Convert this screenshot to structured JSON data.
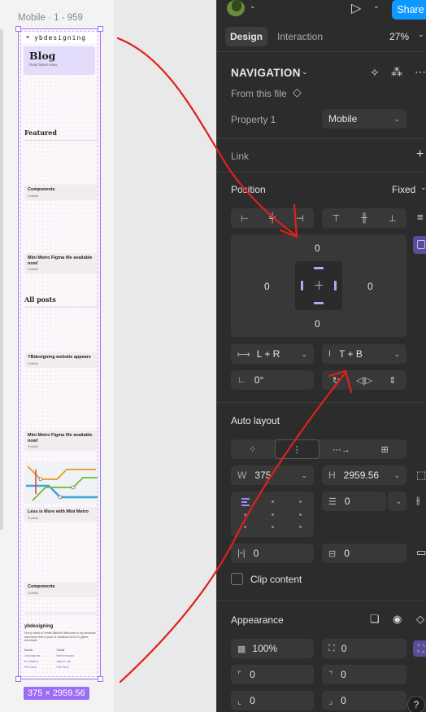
{
  "canvas": {
    "frame_label": "Mobile · 1 - 959",
    "size_badge": "375 × 2959.56",
    "mobile": {
      "logo": "ybdesigning",
      "hero_title": "Blog",
      "hero_subtitle": "Read latest news",
      "featured_title": "Featured",
      "all_posts_title": "All posts",
      "cards": [
        {
          "title": "Components",
          "subtitle": "Subtitle"
        },
        {
          "title": "Mini Metro Figma file available now!",
          "subtitle": "Subtitle"
        },
        {
          "title": "YBdesigning website appears",
          "subtitle": "Subtitle"
        },
        {
          "title": "Mini Metro Figma file available now!",
          "subtitle": "Subtitle"
        },
        {
          "title": "Less is More with Mini Metro",
          "subtitle": "Subtitle"
        },
        {
          "title": "Components",
          "subtitle": "Subtitle"
        }
      ],
      "footer": {
        "title": "ybdesigning",
        "desc": "Hi my name is Yende Bakker! Welcome to my personal adventure from a poor of classical UI/UX to game developer",
        "col1": [
          "Social",
          "Instagram",
          "Dribbble",
          "Patreon"
        ],
        "col2": [
          "Social",
          "References",
          "About me",
          "Patreon"
        ]
      }
    }
  },
  "panel": {
    "share_label": "Share",
    "tabs": [
      "Design",
      "Interaction"
    ],
    "zoom": "27%",
    "component": {
      "name": "NAVIGATION",
      "source": "From this file",
      "property_label": "Property 1",
      "property_value": "Mobile"
    },
    "link_label": "Link",
    "position": {
      "label": "Position",
      "mode": "Fixed",
      "top": "0",
      "left": "0",
      "right": "0",
      "bottom": "0",
      "horizontal_constraint": "L + R",
      "vertical_constraint": "T + B",
      "rotation": "0°"
    },
    "auto_layout": {
      "label": "Auto layout",
      "width_label": "W",
      "width": "375",
      "height_label": "H",
      "height": "2959.56",
      "gap": "0",
      "padding_h": "0",
      "padding_v": "0",
      "clip_label": "Clip content"
    },
    "appearance": {
      "label": "Appearance",
      "opacity": "100%",
      "corner": "0",
      "r_tl": "0",
      "r_tr": "0",
      "r_bl": "0",
      "r_br": "0"
    },
    "help": "?"
  },
  "colors": {
    "accent": "#9b6cf5",
    "share": "#0d99ff",
    "annotation": "#e0201a"
  }
}
